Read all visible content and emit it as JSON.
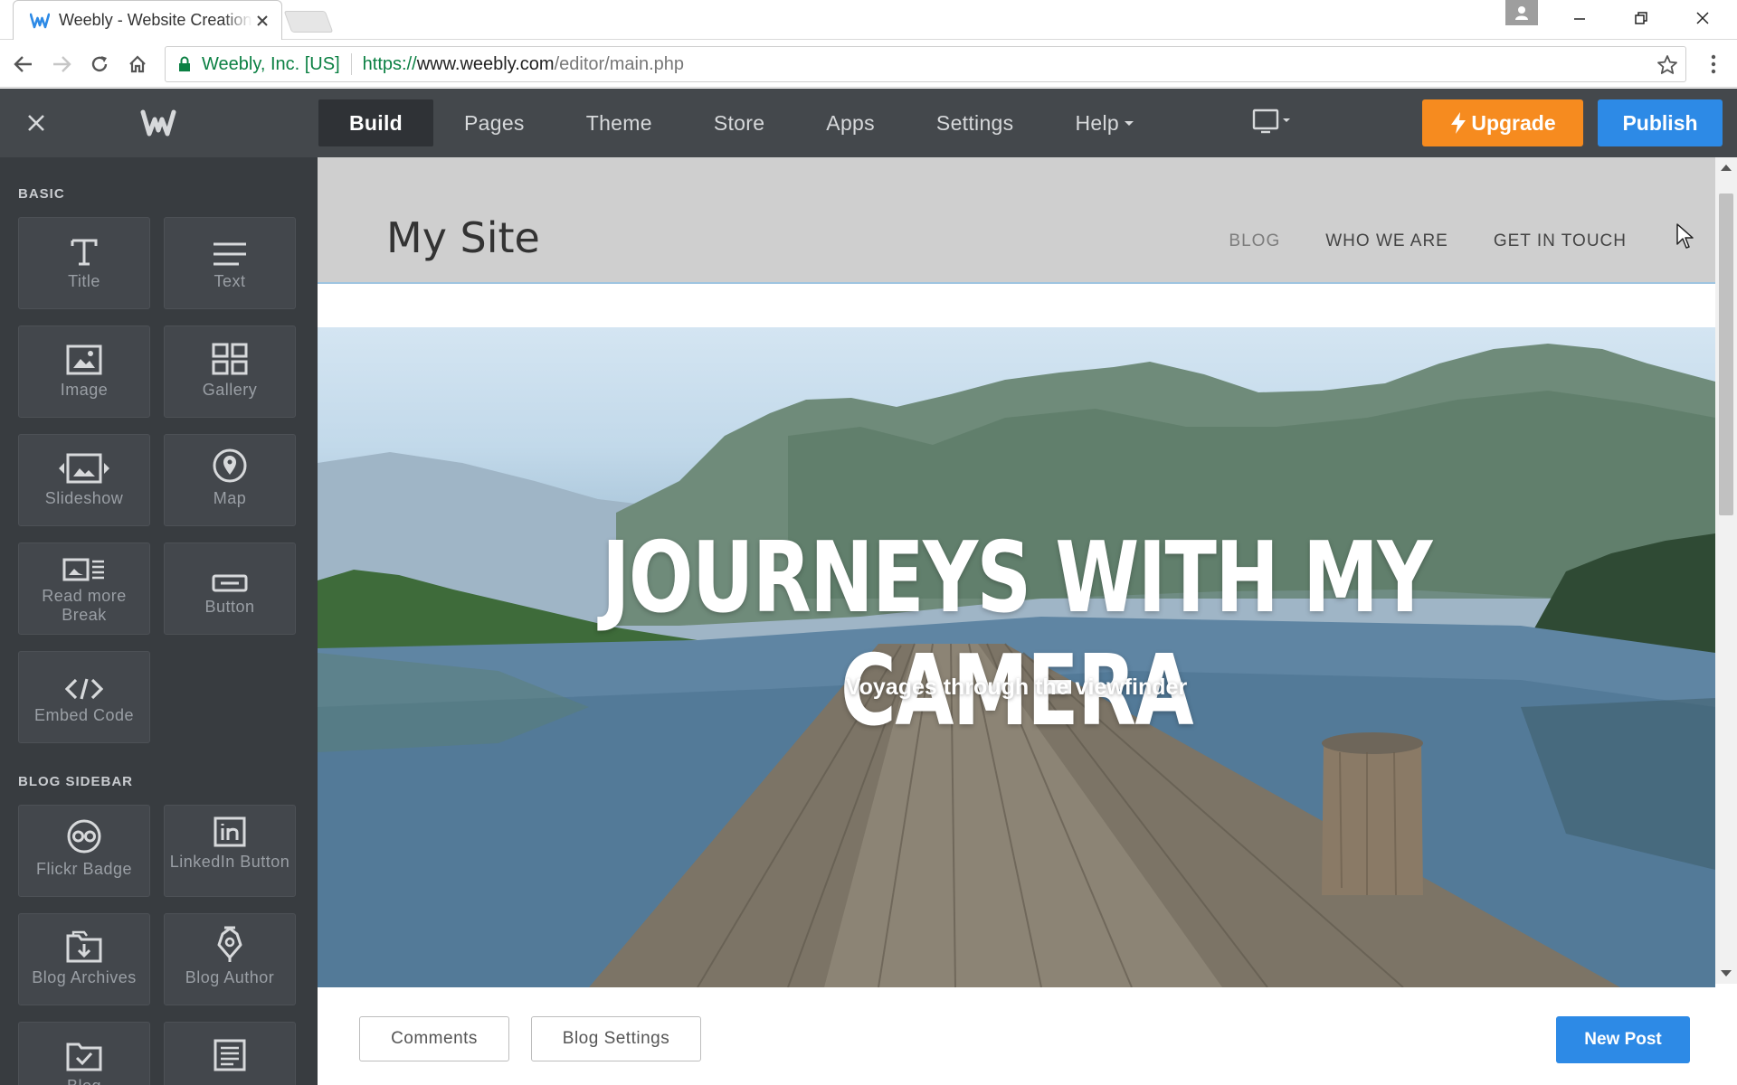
{
  "browser": {
    "tab_title": "Weebly - Website Creation Tool",
    "org": "Weebly, Inc. [US]",
    "url_proto": "https://",
    "url_host": "www.weebly.com",
    "url_path": "/editor/main.php"
  },
  "editor": {
    "tabs": [
      {
        "label": "Build"
      },
      {
        "label": "Pages"
      },
      {
        "label": "Theme"
      },
      {
        "label": "Store"
      },
      {
        "label": "Apps"
      },
      {
        "label": "Settings"
      },
      {
        "label": "Help"
      }
    ],
    "upgrade_label": "Upgrade",
    "publish_label": "Publish",
    "colors": {
      "upgrade": "#f68b1f",
      "publish": "#2d8ae6",
      "toolbar": "#44484c",
      "sidebar": "#383c40"
    }
  },
  "sidebar": {
    "basic_label": "BASIC",
    "basic": [
      {
        "label": "Title",
        "icon": "title-icon"
      },
      {
        "label": "Text",
        "icon": "text-icon"
      },
      {
        "label": "Image",
        "icon": "image-icon"
      },
      {
        "label": "Gallery",
        "icon": "gallery-icon"
      },
      {
        "label": "Slideshow",
        "icon": "slideshow-icon"
      },
      {
        "label": "Map",
        "icon": "map-pin-icon"
      },
      {
        "label": "Read more Break",
        "icon": "read-more-icon"
      },
      {
        "label": "Button",
        "icon": "button-icon"
      },
      {
        "label": "Embed Code",
        "icon": "code-icon"
      }
    ],
    "blog_label": "BLOG SIDEBAR",
    "blog": [
      {
        "label": "Flickr Badge",
        "icon": "flickr-icon"
      },
      {
        "label": "LinkedIn Button",
        "icon": "linkedin-icon"
      },
      {
        "label": "Blog Archives",
        "icon": "archives-icon"
      },
      {
        "label": "Blog Author",
        "icon": "author-pen-icon"
      },
      {
        "label": "Blog",
        "icon": "blog-categories-icon"
      },
      {
        "label": "",
        "icon": "blog-posts-icon"
      }
    ]
  },
  "site": {
    "title": "My Site",
    "nav": [
      "BLOG",
      "WHO WE ARE",
      "GET IN TOUCH"
    ],
    "hero_title": "JOURNEYS WITH MY CAMERA",
    "hero_subtitle": "Voyages through the viewfinder"
  },
  "blog_bar": {
    "comments_label": "Comments",
    "settings_label": "Blog Settings",
    "new_post_label": "New Post"
  }
}
